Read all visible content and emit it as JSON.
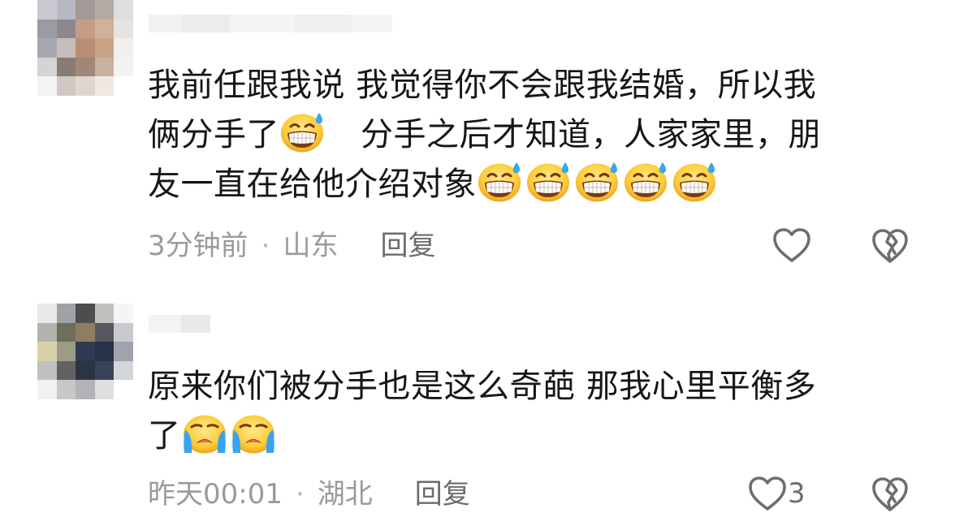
{
  "comments": [
    {
      "content_line1": "我前任跟我说 我觉得你不会跟我结婚，所以我",
      "content_line2a": "俩分手了",
      "content_line2b": "分手之后才知道，人家家里，朋",
      "content_line3": "友一直在给他介绍对象",
      "time": "3分钟前",
      "location": "山东",
      "reply_label": "回复",
      "like_count": "",
      "emojis": [
        "grinning-sweat-emoji",
        "grinning-sweat-emoji",
        "grinning-sweat-emoji",
        "grinning-sweat-emoji",
        "grinning-sweat-emoji",
        "grinning-sweat-emoji"
      ]
    },
    {
      "content_line1": "原来你们被分手也是这么奇葩 那我心里平衡多",
      "content_line2": "了",
      "time": "昨天00:01",
      "location": "湖北",
      "reply_label": "回复",
      "like_count": "3",
      "emojis": [
        "loudly-crying-emoji",
        "loudly-crying-emoji"
      ]
    }
  ],
  "separator_dot": "·",
  "colors": {
    "text": "#161616",
    "meta": "#9a9a9a",
    "reply": "#6b6b6b",
    "icon": "#6e6e6e"
  },
  "icons": {
    "like": "heart-outline-icon",
    "dislike": "broken-heart-icon"
  }
}
